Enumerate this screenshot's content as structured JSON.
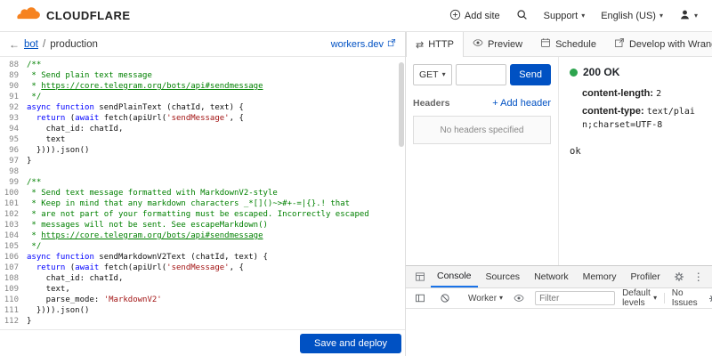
{
  "colors": {
    "brand_orange": "#f6821f",
    "accent_blue": "#0051c3",
    "status_green": "#2da44e",
    "syntax_comment": "#008000",
    "syntax_keyword": "#0000ff",
    "syntax_string": "#a31515"
  },
  "icons": {
    "caret_down": "▾",
    "kebab": "⋮",
    "back_arrow": "←",
    "http_arrows": "⇄"
  },
  "header": {
    "brand": "CLOUDFLARE",
    "add_site_label": "Add site",
    "support_label": "Support",
    "language_label": "English (US)"
  },
  "breadcrumb": {
    "project": "bot",
    "separator": "/",
    "environment": "production",
    "workers_link": "workers.dev"
  },
  "editor": {
    "save_button": "Save and deploy",
    "lines": [
      {
        "n": 88,
        "t": [
          [
            "c",
            "/**"
          ]
        ]
      },
      {
        "n": 89,
        "t": [
          [
            "c",
            " * Send plain text message"
          ]
        ]
      },
      {
        "n": 90,
        "t": [
          [
            "c",
            " * "
          ],
          [
            "l",
            "https://core.telegram.org/bots/api#sendmessage"
          ]
        ]
      },
      {
        "n": 91,
        "t": [
          [
            "c",
            " */"
          ]
        ]
      },
      {
        "n": 92,
        "t": [
          [
            "k",
            "async"
          ],
          [
            "p",
            " "
          ],
          [
            "k",
            "function"
          ],
          [
            "p",
            " sendPlainText (chatId, text) {"
          ]
        ]
      },
      {
        "n": 93,
        "t": [
          [
            "p",
            "  "
          ],
          [
            "k",
            "return"
          ],
          [
            "p",
            " ("
          ],
          [
            "k",
            "await"
          ],
          [
            "p",
            " fetch(apiUrl("
          ],
          [
            "s",
            "'sendMessage'"
          ],
          [
            "p",
            ", {"
          ]
        ]
      },
      {
        "n": 94,
        "t": [
          [
            "p",
            "    chat_id: chatId,"
          ]
        ]
      },
      {
        "n": 95,
        "t": [
          [
            "p",
            "    text"
          ]
        ]
      },
      {
        "n": 96,
        "t": [
          [
            "p",
            "  }))).json()"
          ]
        ]
      },
      {
        "n": 97,
        "t": [
          [
            "p",
            "}"
          ]
        ]
      },
      {
        "n": 98,
        "t": []
      },
      {
        "n": 99,
        "t": [
          [
            "c",
            "/**"
          ]
        ]
      },
      {
        "n": 100,
        "t": [
          [
            "c",
            " * Send text message formatted with MarkdownV2-style"
          ]
        ]
      },
      {
        "n": 101,
        "t": [
          [
            "c",
            " * Keep in mind that any markdown characters _*[]()~>#+-=|{}.! that"
          ]
        ]
      },
      {
        "n": 102,
        "t": [
          [
            "c",
            " * are not part of your formatting must be escaped. Incorrectly escaped"
          ]
        ]
      },
      {
        "n": 103,
        "t": [
          [
            "c",
            " * messages will not be sent. See escapeMarkdown()"
          ]
        ]
      },
      {
        "n": 104,
        "t": [
          [
            "c",
            " * "
          ],
          [
            "l",
            "https://core.telegram.org/bots/api#sendmessage"
          ]
        ]
      },
      {
        "n": 105,
        "t": [
          [
            "c",
            " */"
          ]
        ]
      },
      {
        "n": 106,
        "t": [
          [
            "k",
            "async"
          ],
          [
            "p",
            " "
          ],
          [
            "k",
            "function"
          ],
          [
            "p",
            " sendMarkdownV2Text (chatId, text) {"
          ]
        ]
      },
      {
        "n": 107,
        "t": [
          [
            "p",
            "  "
          ],
          [
            "k",
            "return"
          ],
          [
            "p",
            " ("
          ],
          [
            "k",
            "await"
          ],
          [
            "p",
            " fetch(apiUrl("
          ],
          [
            "s",
            "'sendMessage'"
          ],
          [
            "p",
            ", {"
          ]
        ]
      },
      {
        "n": 108,
        "t": [
          [
            "p",
            "    chat_id: chatId,"
          ]
        ]
      },
      {
        "n": 109,
        "t": [
          [
            "p",
            "    text,"
          ]
        ]
      },
      {
        "n": 110,
        "t": [
          [
            "p",
            "    parse_mode: "
          ],
          [
            "s",
            "'MarkdownV2'"
          ]
        ]
      },
      {
        "n": 111,
        "t": [
          [
            "p",
            "  }))).json()"
          ]
        ]
      },
      {
        "n": 112,
        "t": [
          [
            "p",
            "}"
          ]
        ]
      }
    ]
  },
  "http_panel": {
    "tabs": [
      {
        "label": "HTTP"
      },
      {
        "label": "Preview"
      },
      {
        "label": "Schedule"
      },
      {
        "label": "Develop with Wrangler CLI"
      }
    ],
    "method": "GET",
    "url_value": "",
    "send_button": "Send",
    "headers_label": "Headers",
    "add_header_label": "+ Add header",
    "no_headers_message": "No headers specified"
  },
  "response": {
    "status": "200 OK",
    "headers": [
      {
        "name": "content-length:",
        "value": "2"
      },
      {
        "name": "content-type:",
        "value": "text/plain;charset=UTF-8"
      }
    ],
    "body": "ok"
  },
  "devtools": {
    "tabs": [
      "Console",
      "Sources",
      "Network",
      "Memory",
      "Profiler"
    ],
    "context_label": "Worker",
    "filter_placeholder": "Filter",
    "levels_label": "Default levels",
    "issues_label": "No Issues"
  }
}
